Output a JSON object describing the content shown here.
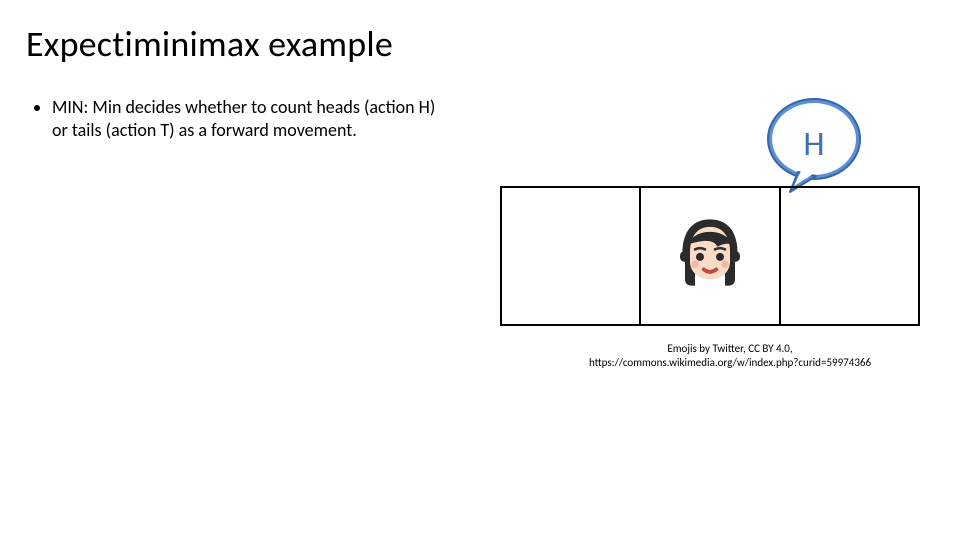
{
  "title": "Expectiminimax example",
  "bullet": "MIN: Min decides whether to count heads (action H) or tails (action T) as a forward movement.",
  "bubble_label": "H",
  "credit_line1": "Emojis by Twitter, CC BY 4.0,",
  "credit_line2": "https://commons.wikimedia.org/w/index.php?curid=59974366",
  "bubble_colors": {
    "fill": "#5b8fd6",
    "stroke": "#3766a6"
  },
  "emoji_name": "woman-face"
}
